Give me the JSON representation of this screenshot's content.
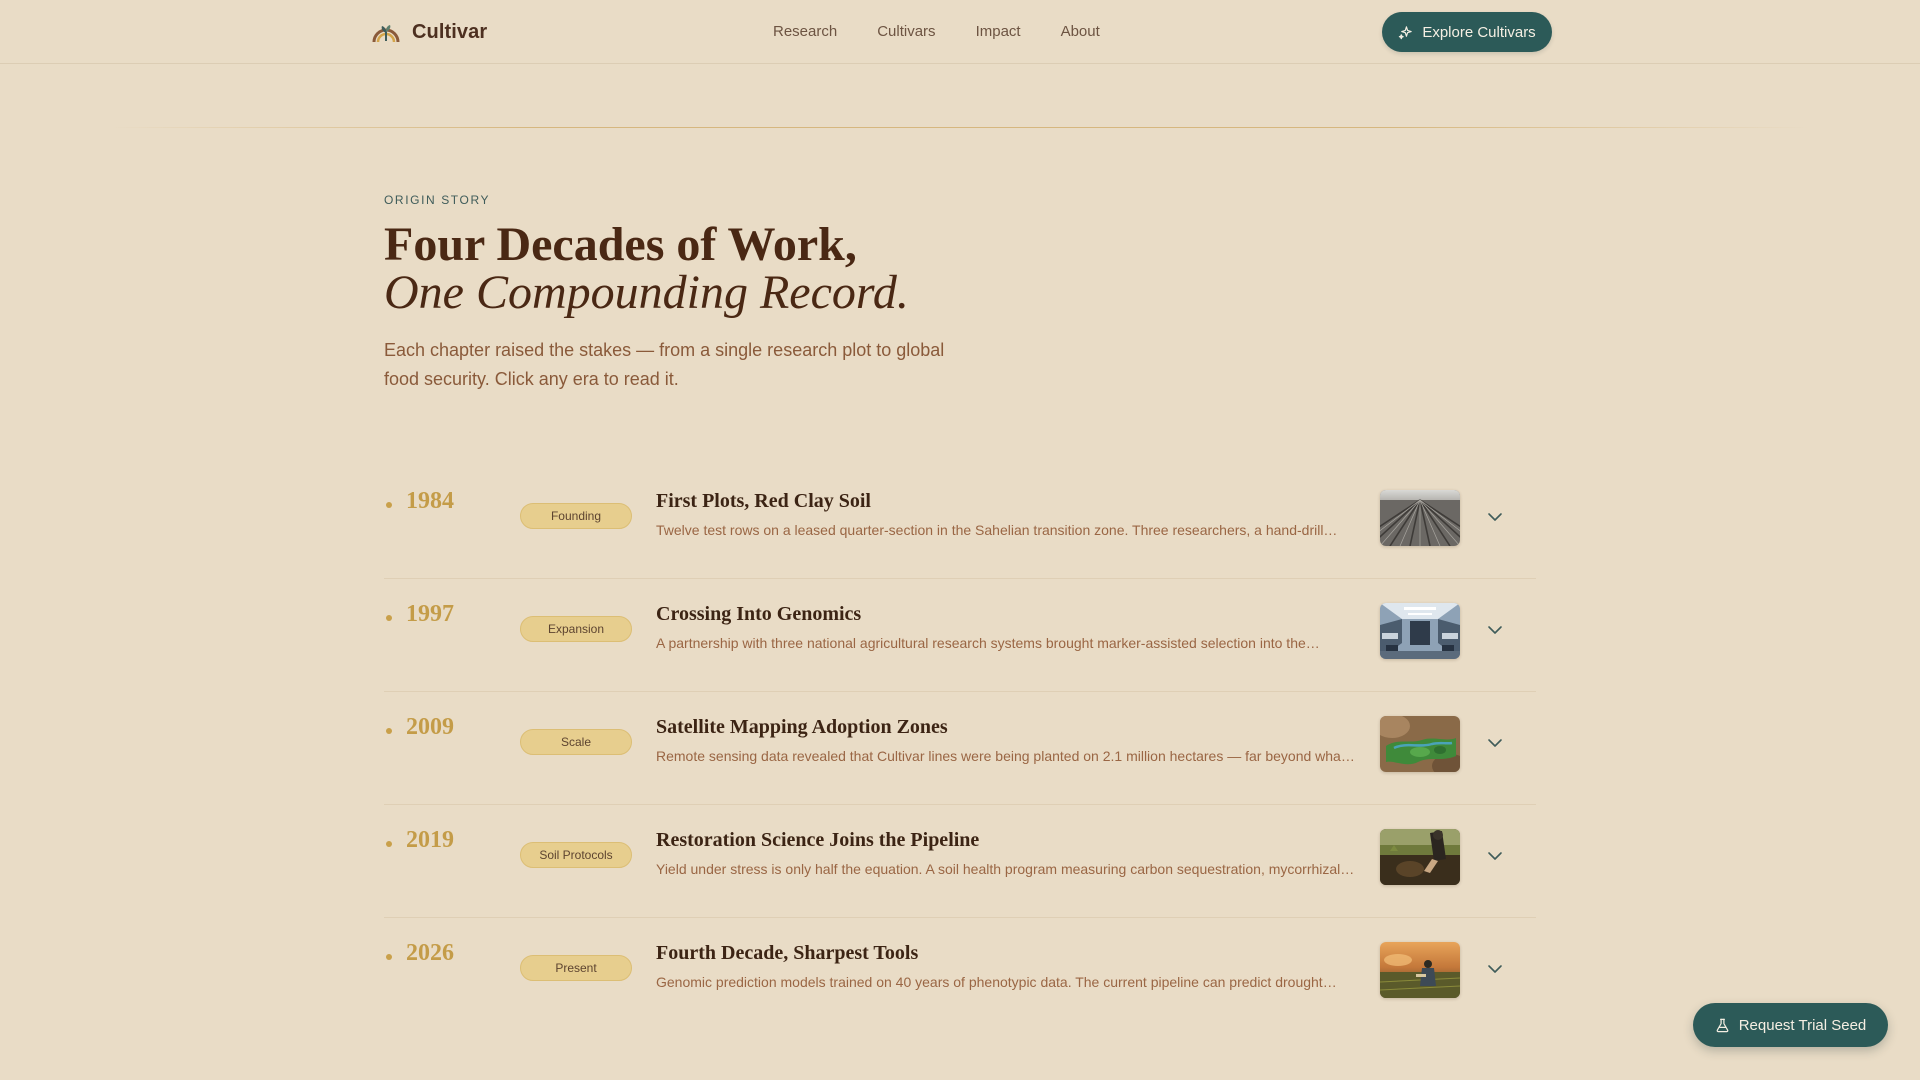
{
  "brand": {
    "name": "Cultivar",
    "logo_icon": "sprout-arch-icon"
  },
  "nav": {
    "items": [
      {
        "label": "Research"
      },
      {
        "label": "Cultivars"
      },
      {
        "label": "Impact"
      },
      {
        "label": "About"
      }
    ],
    "cta_label": "Explore Cultivars",
    "cta_icon": "sparkles-icon"
  },
  "hero": {
    "eyebrow": "ORIGIN STORY",
    "title_line1": "Four Decades of Work,",
    "title_line2": "One Compounding Record.",
    "lede": "Each chapter raised the stakes — from a single research plot to global food security. Click any era to read it."
  },
  "timeline": {
    "eras": [
      {
        "year": "1984",
        "tag": "Founding",
        "title": "First Plots, Red Clay Soil",
        "description": "Twelve test rows on a leased quarter-section in the Sahelian transition zone. Three researchers, a hand-drill…",
        "thumbnail": "plowed-field-image"
      },
      {
        "year": "1997",
        "tag": "Expansion",
        "title": "Crossing Into Genomics",
        "description": "A partnership with three national agricultural research systems brought marker-assisted selection into the…",
        "thumbnail": "laboratory-image"
      },
      {
        "year": "2009",
        "tag": "Scale",
        "title": "Satellite Mapping Adoption Zones",
        "description": "Remote sensing data revealed that Cultivar lines were being planted on 2.1 million hectares — far beyond wha…",
        "thumbnail": "satellite-landscape-image"
      },
      {
        "year": "2019",
        "tag": "Soil Protocols",
        "title": "Restoration Science Joins the Pipeline",
        "description": "Yield under stress is only half the equation. A soil health program measuring carbon sequestration, mycorrhizal…",
        "thumbnail": "soil-sampling-image"
      },
      {
        "year": "2026",
        "tag": "Present",
        "title": "Fourth Decade, Sharpest Tools",
        "description": "Genomic prediction models trained on 40 years of phenotypic data. The current pipeline can predict drought…",
        "thumbnail": "field-researcher-image"
      }
    ],
    "expand_icon": "chevron-down-icon"
  },
  "floating_cta": {
    "label": "Request Trial Seed",
    "icon": "flask-icon"
  },
  "colors": {
    "background": "#e9dcc6",
    "primary_button": "#2c5a58",
    "heading": "#4a2814",
    "year_gold": "#c49c48",
    "tag_fill": "#e7ce8e",
    "body_brown": "#8a5a3a"
  }
}
